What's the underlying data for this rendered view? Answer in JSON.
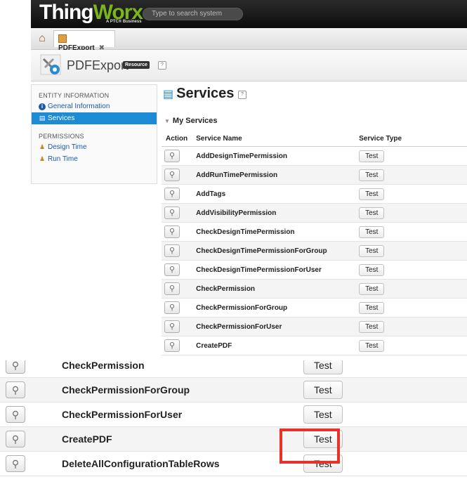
{
  "app": {
    "logo_main": "Thing",
    "logo_accent": "Worx",
    "logo_tagline": "A PTC® Business",
    "search_placeholder": "Type to search system"
  },
  "tab": {
    "label": "PDFExport",
    "close_glyph": "✖"
  },
  "entity": {
    "name": "PDFExport",
    "badge": "Resource",
    "help": "?"
  },
  "sidebar": {
    "section_entity": "ENTITY INFORMATION",
    "item_general": "General Information",
    "item_services": "Services",
    "section_permissions": "PERMISSIONS",
    "item_design_time": "Design Time",
    "item_run_time": "Run Time"
  },
  "services": {
    "title": "Services",
    "help": "?",
    "section": "My Services",
    "columns": [
      "Action",
      "Service Name",
      "Service Type"
    ],
    "test_label": "Test",
    "rows": [
      "AddDesignTimePermission",
      "AddRunTimePermission",
      "AddTags",
      "AddVisibilityPermission",
      "CheckDesignTimePermission",
      "CheckDesignTimePermissionForGroup",
      "CheckDesignTimePermissionForUser",
      "CheckPermission",
      "CheckPermissionForGroup",
      "CheckPermissionForUser",
      "CreatePDF"
    ]
  },
  "zoom": {
    "test_label": "Test",
    "rows": [
      "CheckPermission",
      "CheckPermissionForGroup",
      "CheckPermissionForUser",
      "CreatePDF",
      "DeleteAllConfigurationTableRows"
    ]
  },
  "colors": {
    "highlight": "#e8312a",
    "accent": "#1c8ad4",
    "logo_green": "#7ab51d"
  },
  "icons": {
    "home": "home-icon",
    "action": "magnifier-icon",
    "info": "info-icon",
    "services": "services-icon",
    "design_time": "user-lock-icon",
    "run_time": "user-lock-icon"
  }
}
